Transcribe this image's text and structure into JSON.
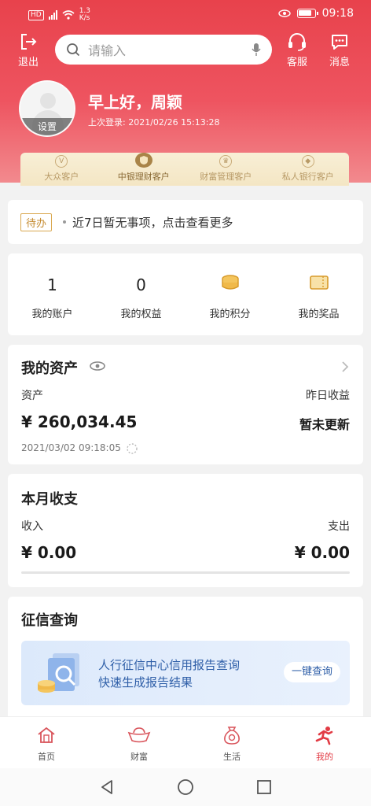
{
  "status_bar": {
    "network": "HD",
    "signal": "4G",
    "speed": "1.3",
    "speed_unit": "K/s",
    "time": "09:18"
  },
  "topbar": {
    "logout_label": "退出",
    "search_placeholder": "请输入",
    "service_label": "客服",
    "message_label": "消息"
  },
  "profile": {
    "avatar_set_label": "设置",
    "greeting": "早上好，周颖",
    "last_login": "上次登录: 2021/02/26 15:13:28"
  },
  "tiers": [
    {
      "label": "大众客户",
      "icon": "v-badge-icon"
    },
    {
      "label": "中银理财客户",
      "icon": "shield-badge-icon",
      "active": true
    },
    {
      "label": "财富管理客户",
      "icon": "crown-badge-icon"
    },
    {
      "label": "私人银行客户",
      "icon": "gem-badge-icon"
    }
  ],
  "todo": {
    "tag": "待办",
    "message": "近7日暂无事项，点击查看更多"
  },
  "stats": [
    {
      "value": "1",
      "label": "我的账户"
    },
    {
      "value": "0",
      "label": "我的权益"
    },
    {
      "value": "",
      "label": "我的积分",
      "icon": "coins-icon"
    },
    {
      "value": "",
      "label": "我的奖品",
      "icon": "ticket-icon"
    }
  ],
  "assets": {
    "title": "我的资产",
    "asset_label": "资产",
    "asset_value": "¥ 260,034.45",
    "yesterday_label": "昨日收益",
    "yesterday_value": "暂未更新",
    "timestamp": "2021/03/02 09:18:05"
  },
  "monthly": {
    "title": "本月收支",
    "income_label": "收入",
    "income_value": "¥ 0.00",
    "expense_label": "支出",
    "expense_value": "¥ 0.00"
  },
  "credit": {
    "title": "征信查询",
    "banner_line1": "人行征信中心信用报告查询",
    "banner_line2": "快速生成报告结果",
    "button": "一键查询"
  },
  "bottom_nav": [
    {
      "label": "首页",
      "icon": "home-icon"
    },
    {
      "label": "财富",
      "icon": "ingot-icon"
    },
    {
      "label": "生活",
      "icon": "money-bag-icon"
    },
    {
      "label": "我的",
      "icon": "runner-icon",
      "active": true
    }
  ],
  "colors": {
    "brand_red": "#e8424c",
    "gold": "#a98448",
    "credit_blue": "#2f5fa8",
    "coin_gold": "#e0a93a"
  }
}
